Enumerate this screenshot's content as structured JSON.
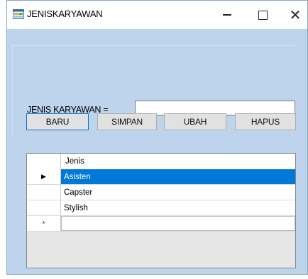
{
  "window": {
    "title": "JENISKARYAWAN",
    "controls": {
      "minimize": "—",
      "maximize": "☐",
      "close": "✕"
    }
  },
  "form": {
    "field_label": "JENIS KARYAWAN =",
    "field_value": "",
    "buttons": {
      "baru": "BARU",
      "simpan": "SIMPAN",
      "ubah": "UBAH",
      "hapus": "HAPUS"
    }
  },
  "grid": {
    "column_header": "Jenis",
    "rows": [
      {
        "value": "Asisten",
        "row_marker": "▶",
        "selected": true
      },
      {
        "value": "Capster",
        "row_marker": "",
        "selected": false
      },
      {
        "value": "Stylish",
        "row_marker": "",
        "selected": false
      }
    ],
    "new_row_marker": "*"
  },
  "colors": {
    "selection": "#0078d7",
    "form_background": "#bed4ec"
  }
}
